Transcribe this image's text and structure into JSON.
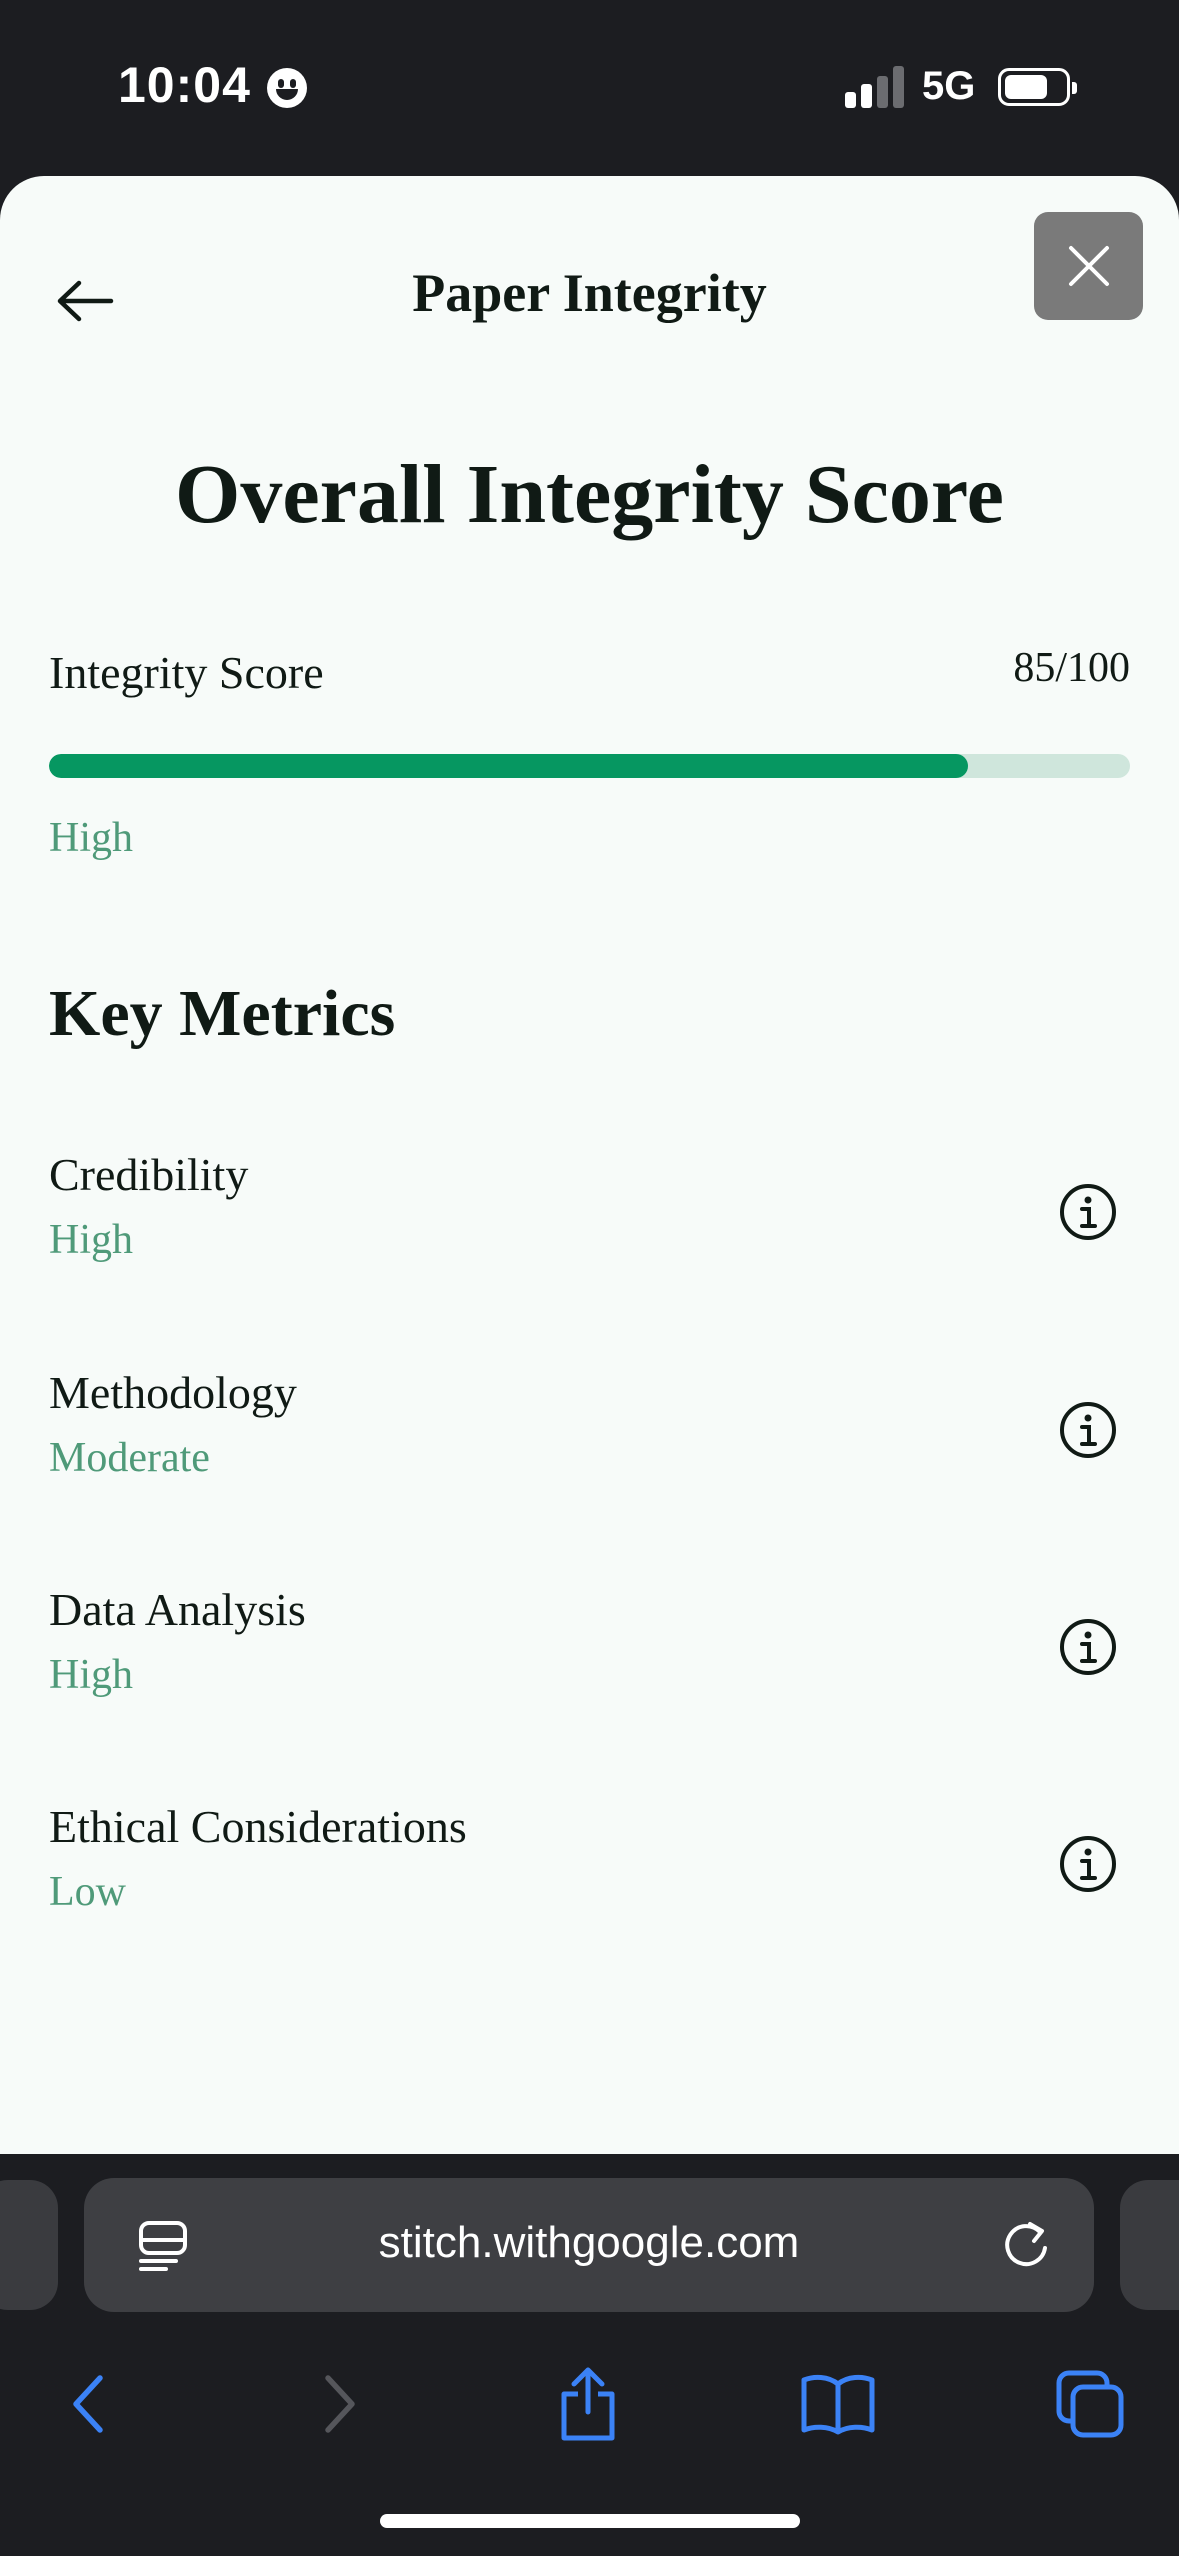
{
  "status_bar": {
    "time": "10:04",
    "network": "5G",
    "signal_bars_active": 2,
    "signal_bars_total": 4
  },
  "header": {
    "title": "Paper Integrity",
    "back_icon": "arrow-left-icon",
    "close_icon": "close-icon"
  },
  "score": {
    "heading": "Overall Integrity Score",
    "label": "Integrity Score",
    "value_text": "85/100",
    "value": 85,
    "max": 100,
    "rating": "High"
  },
  "metrics": {
    "heading": "Key Metrics",
    "items": [
      {
        "name": "Credibility",
        "rating": "High"
      },
      {
        "name": "Methodology",
        "rating": "Moderate"
      },
      {
        "name": "Data Analysis",
        "rating": "High"
      },
      {
        "name": "Ethical Considerations",
        "rating": "Low"
      }
    ]
  },
  "browser": {
    "url": "stitch.withgoogle.com",
    "icons": [
      "reader-icon",
      "reload-icon",
      "back-icon",
      "forward-icon",
      "share-icon",
      "bookmarks-icon",
      "tabs-icon"
    ]
  },
  "colors": {
    "accent": "#069761",
    "track": "#cfe6dc",
    "rating_text": "#4f9a79",
    "sheet_bg": "#f7fbf9",
    "chrome_bg": "#1c1d21"
  }
}
